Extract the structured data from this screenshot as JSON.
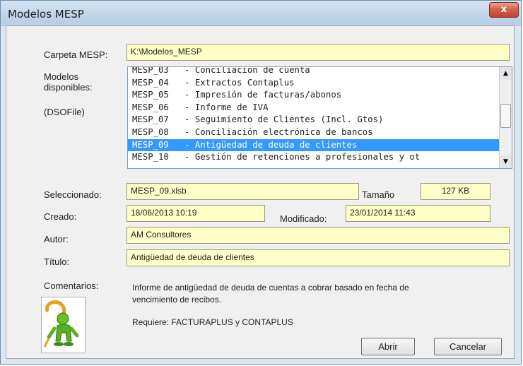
{
  "window": {
    "title": "Modelos MESP",
    "close_label": "x"
  },
  "labels": {
    "carpeta": "Carpeta MESP:",
    "modelos": "Modelos\ndisponibles:",
    "dsofile": "(DSOFile)",
    "seleccionado": "Seleccionado:",
    "tamano": "Tamaño",
    "creado": "Creado:",
    "modificado": "Modificado:",
    "autor": "Autor:",
    "titulo": "Título:",
    "comentarios": "Comentarios:"
  },
  "fields": {
    "carpeta": "K:\\Modelos_MESP",
    "seleccionado": "MESP_09.xlsb",
    "tamano": "127 KB",
    "creado": "18/06/2013 10:19",
    "modificado": "23/01/2014 11:43",
    "autor": "AM Consultores",
    "titulo": "Antigüedad de deuda de clientes"
  },
  "models": [
    "MESP_03   - Conciliación de cuenta",
    "MESP_04   - Extractos Contaplus",
    "MESP_05   - Impresión de facturas/abonos",
    "MESP_06   - Informe de IVA",
    "MESP_07   - Seguimiento de Clientes (Incl. Gtos)",
    "MESP_08   - Conciliación electrónica de bancos",
    "MESP_09   - Antigüedad de deuda de clientes",
    "MESP_10   - Gestión de retenciones a profesionales y ot"
  ],
  "selected_index": 6,
  "comments": {
    "line1": "Informe de antigüedad de deuda de cuentas a cobrar basado en fecha de",
    "line2": "vencimiento de recibos.",
    "requires": "Requiere: FACTURAPLUS y CONTAPLUS"
  },
  "buttons": {
    "open": "Abrir",
    "cancel": "Cancelar"
  },
  "icons": {
    "scroll_up": "scroll-up-arrow",
    "scroll_down": "scroll-down-arrow",
    "logo": "person-figure-logo"
  },
  "colors": {
    "field_bg": "#ffffc8",
    "selection": "#3399ff"
  }
}
